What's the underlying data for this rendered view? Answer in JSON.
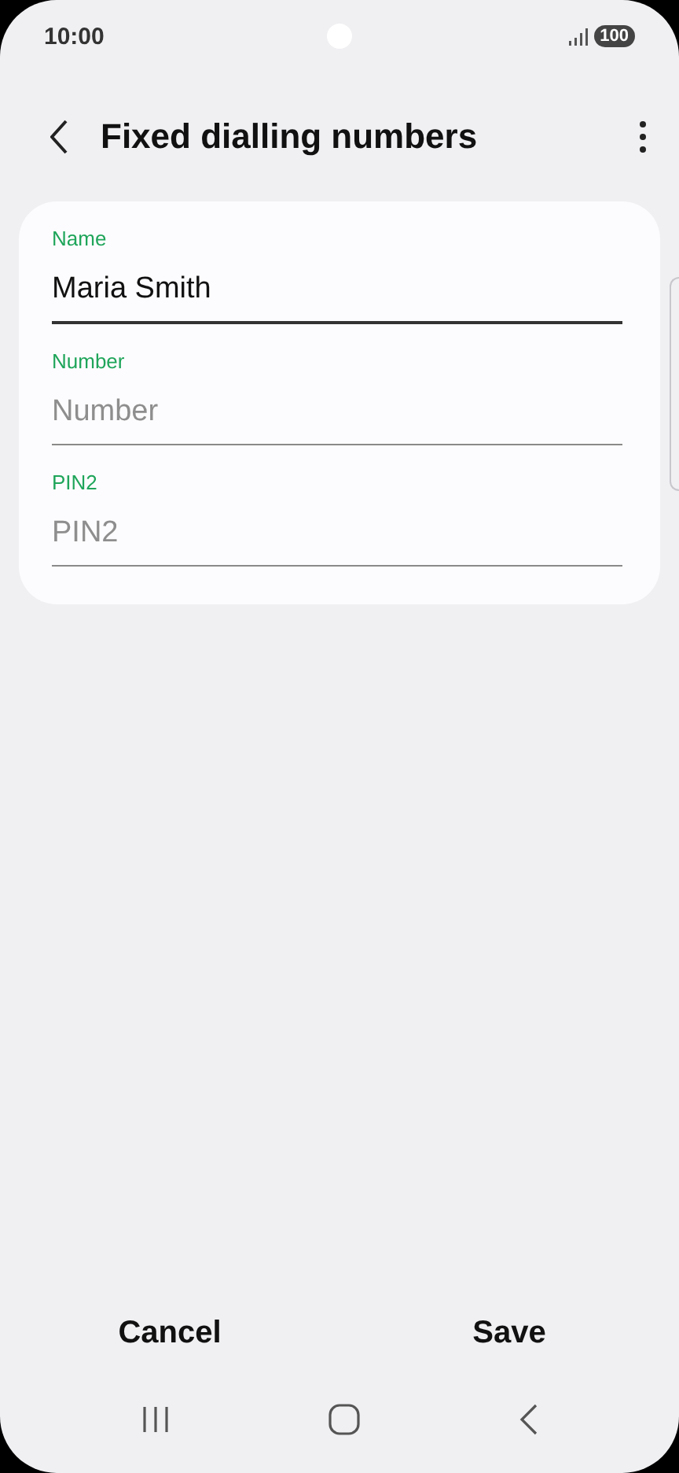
{
  "status_bar": {
    "time": "10:00",
    "battery": "100"
  },
  "header": {
    "title": "Fixed dialling numbers"
  },
  "fields": [
    {
      "label": "Name",
      "value": "Maria Smith",
      "focused": true
    },
    {
      "label": "Number",
      "placeholder": "Number",
      "focused": false
    },
    {
      "label": "PIN2",
      "placeholder": "PIN2",
      "focused": false
    }
  ],
  "buttons": [
    "Cancel",
    "Save"
  ]
}
